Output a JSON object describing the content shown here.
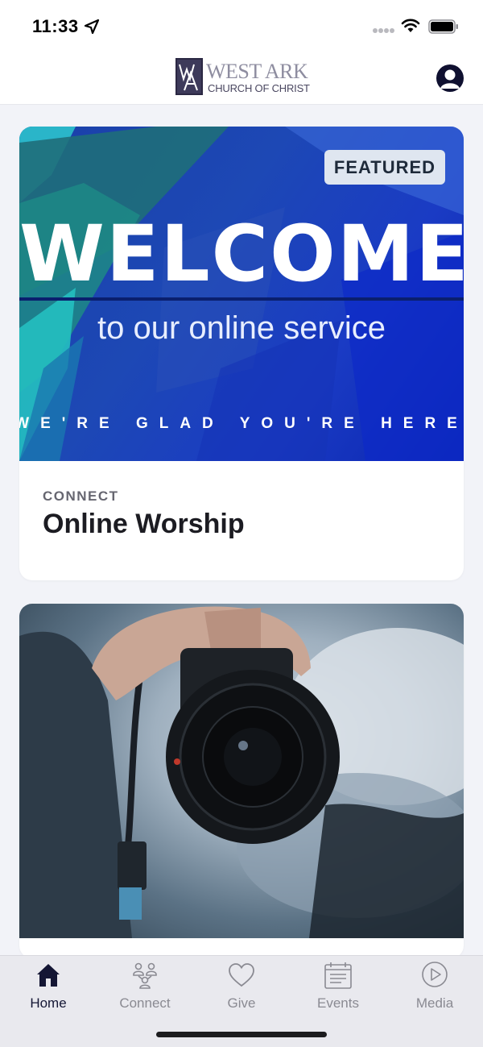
{
  "status_bar": {
    "time": "11:33",
    "icons": [
      "location-arrow-icon",
      "signal-dots-icon",
      "wifi-icon",
      "battery-icon"
    ]
  },
  "header": {
    "logo_title": "WEST ARK",
    "logo_subtitle": "CHURCH OF CHRIST",
    "logo_mark": "WA",
    "profile_icon": "user-circle-icon"
  },
  "cards": [
    {
      "badge": "FEATURED",
      "image_headline": "WELCOME",
      "image_subline": "to our online service",
      "image_tagline": "WE'RE GLAD YOU'RE HERE",
      "category": "CONNECT",
      "title": "Online Worship"
    },
    {
      "image": "photographer-holding-camera"
    }
  ],
  "tabs": [
    {
      "label": "Home",
      "icon": "home-icon",
      "active": true
    },
    {
      "label": "Connect",
      "icon": "people-icon",
      "active": false
    },
    {
      "label": "Give",
      "icon": "heart-icon",
      "active": false
    },
    {
      "label": "Events",
      "icon": "calendar-icon",
      "active": false
    },
    {
      "label": "Media",
      "icon": "play-circle-icon",
      "active": false
    }
  ],
  "colors": {
    "accent": "#141634",
    "tab_inactive": "#8a8a92",
    "background": "#f2f3f8",
    "welcome_blue": "#1d48b5"
  }
}
